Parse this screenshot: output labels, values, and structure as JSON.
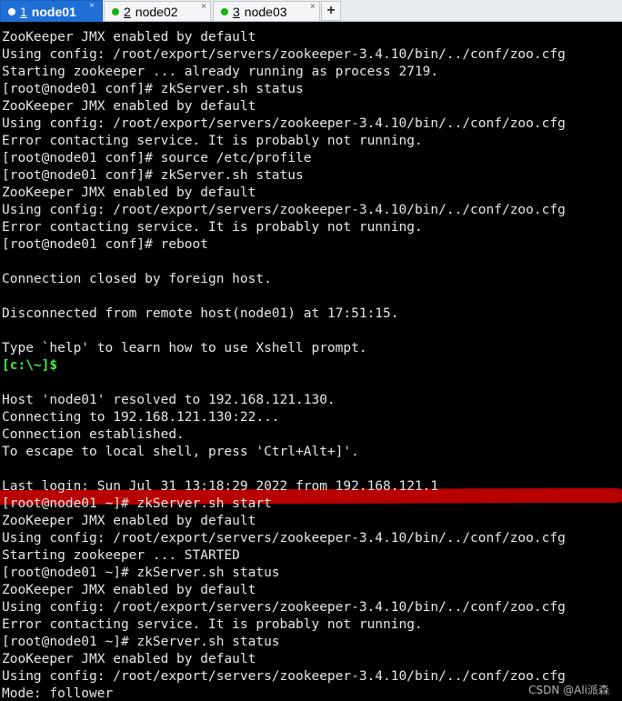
{
  "tabs": [
    {
      "num": "1",
      "label": "node01",
      "active": true
    },
    {
      "num": "2",
      "label": "node02",
      "active": false
    },
    {
      "num": "3",
      "label": "node03",
      "active": false
    }
  ],
  "tab_close_glyph": "×",
  "tab_add_glyph": "+",
  "status_dot_color": "#12b312",
  "active_tab_color": "#1f6fd6",
  "terminal": {
    "lines": [
      "ZooKeeper JMX enabled by default",
      "Using config: /root/export/servers/zookeeper-3.4.10/bin/../conf/zoo.cfg",
      "Starting zookeeper ... already running as process 2719.",
      "[root@node01 conf]# zkServer.sh status",
      "ZooKeeper JMX enabled by default",
      "Using config: /root/export/servers/zookeeper-3.4.10/bin/../conf/zoo.cfg",
      "Error contacting service. It is probably not running.",
      "[root@node01 conf]# source /etc/profile",
      "[root@node01 conf]# zkServer.sh status",
      "ZooKeeper JMX enabled by default",
      "Using config: /root/export/servers/zookeeper-3.4.10/bin/../conf/zoo.cfg",
      "Error contacting service. It is probably not running.",
      "[root@node01 conf]# reboot",
      "",
      "Connection closed by foreign host.",
      "",
      "Disconnected from remote host(node01) at 17:51:15.",
      "",
      "Type `help' to learn how to use Xshell prompt.",
      "[c:\\~]$",
      "",
      "Host 'node01' resolved to 192.168.121.130.",
      "Connecting to 192.168.121.130:22...",
      "Connection established.",
      "To escape to local shell, press 'Ctrl+Alt+]'.",
      "",
      "Last login: Sun Jul 31 13:18:29 2022 from 192.168.121.1",
      "[root@node01 ~]# zkServer.sh start",
      "ZooKeeper JMX enabled by default",
      "Using config: /root/export/servers/zookeeper-3.4.10/bin/../conf/zoo.cfg",
      "Starting zookeeper ... STARTED",
      "[root@node01 ~]# zkServer.sh status",
      "ZooKeeper JMX enabled by default",
      "Using config: /root/export/servers/zookeeper-3.4.10/bin/../conf/zoo.cfg",
      "Error contacting service. It is probably not running.",
      "[root@node01 ~]# zkServer.sh status",
      "ZooKeeper JMX enabled by default",
      "Using config: /root/export/servers/zookeeper-3.4.10/bin/../conf/zoo.cfg",
      "Mode: follower"
    ],
    "prompt_line_index": 19,
    "text_color": "#e6e6e6",
    "prompt_color": "#40ee40",
    "background": "#000000",
    "annotation_color": "#b80000"
  },
  "watermark": "CSDN @Ali派森"
}
